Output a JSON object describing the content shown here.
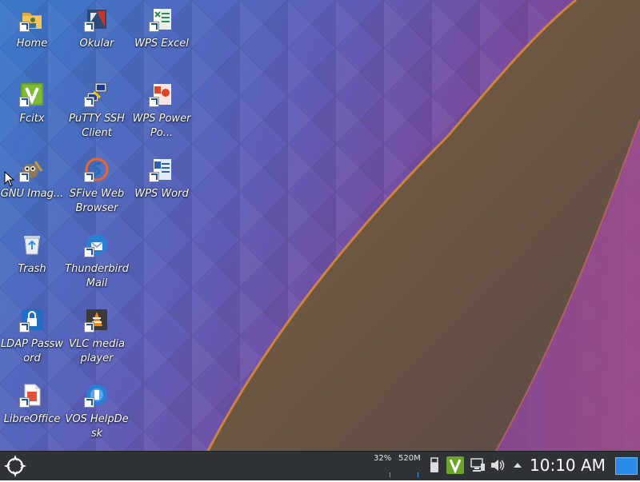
{
  "desktop": {
    "icons": [
      {
        "id": "home",
        "label": "Home",
        "icon": "folder-home-icon"
      },
      {
        "id": "okular",
        "label": "Okular",
        "icon": "okular-icon"
      },
      {
        "id": "wps-excel",
        "label": "WPS Excel",
        "icon": "wps-excel-icon"
      },
      {
        "id": "fcitx",
        "label": "Fcitx",
        "icon": "fcitx-icon"
      },
      {
        "id": "putty",
        "label": "PuTTY SSH Client",
        "icon": "putty-icon"
      },
      {
        "id": "wps-powerpoint",
        "label": "WPS PowerPo...",
        "icon": "wps-powerpoint-icon"
      },
      {
        "id": "gimp",
        "label": "GNU Imag...",
        "icon": "gimp-icon"
      },
      {
        "id": "sfive",
        "label": "SFive Web Browser",
        "icon": "sfive-browser-icon"
      },
      {
        "id": "wps-word",
        "label": "WPS Word",
        "icon": "wps-word-icon"
      },
      {
        "id": "trash",
        "label": "Trash",
        "icon": "trash-icon"
      },
      {
        "id": "thunderbird",
        "label": "Thunderbird Mail",
        "icon": "thunderbird-icon"
      },
      {
        "id": "ldap",
        "label": "LDAP Password",
        "icon": "ldap-password-icon"
      },
      {
        "id": "vlc",
        "label": "VLC media player",
        "icon": "vlc-icon"
      },
      {
        "id": "libreoffice",
        "label": "LibreOffice",
        "icon": "libreoffice-icon"
      },
      {
        "id": "vos-helpdesk",
        "label": "VOS HelpDesk",
        "icon": "vos-helpdesk-icon"
      }
    ]
  },
  "taskbar": {
    "cpu_label": "32%",
    "mem_label": "520M",
    "clock": "10:10 AM",
    "tray": [
      "usb-icon",
      "fcitx-tray-icon",
      "network-icon",
      "volume-icon",
      "expand-tray-icon"
    ],
    "launcher_icon": "application-launcher-icon",
    "show_desktop_icon": "show-desktop-icon"
  },
  "colors": {
    "taskbar_bg": "#2f3236",
    "wallpaper_blue": "#3f73c0",
    "wallpaper_purple": "#7e4f9c",
    "wallpaper_brown": "#6f5848",
    "accent_blue": "#2a8ce4"
  }
}
